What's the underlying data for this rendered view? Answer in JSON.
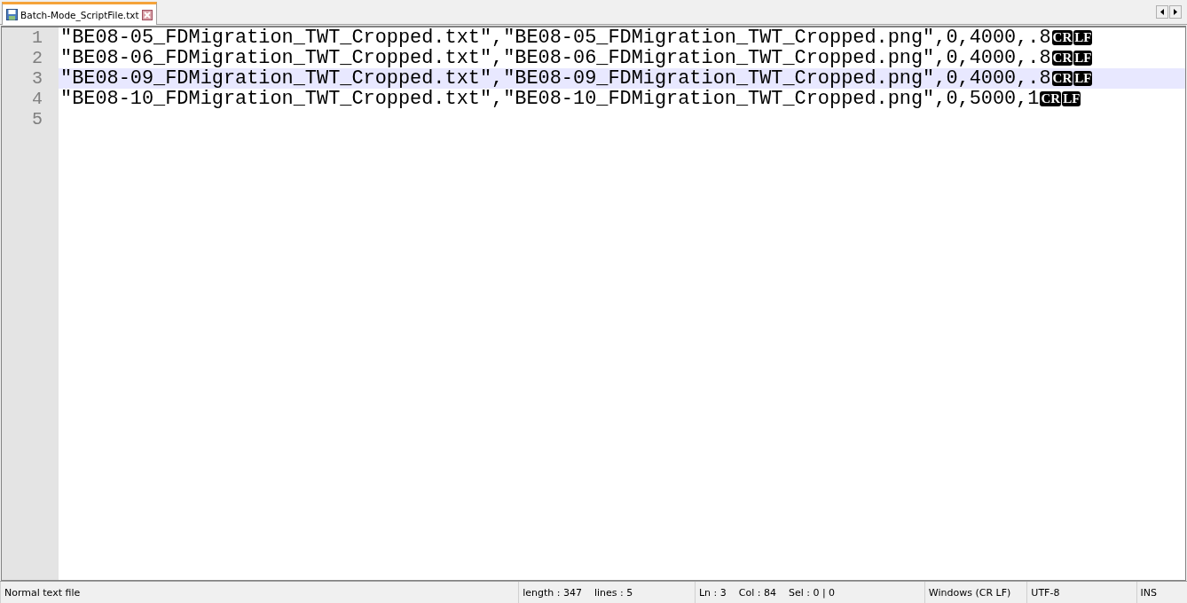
{
  "tabs": [
    {
      "label": "Batch-Mode_ScriptFile.txt",
      "selected": true
    }
  ],
  "editor": {
    "lines": [
      {
        "number": "1",
        "text": "\"BE08-05_FDMigration_TWT_Cropped.txt\",\"BE08-05_FDMigration_TWT_Cropped.png\",0,4000,.8",
        "eol": [
          "CR",
          "LF"
        ],
        "current": false
      },
      {
        "number": "2",
        "text": "\"BE08-06_FDMigration_TWT_Cropped.txt\",\"BE08-06_FDMigration_TWT_Cropped.png\",0,4000,.8",
        "eol": [
          "CR",
          "LF"
        ],
        "current": false
      },
      {
        "number": "3",
        "text": "\"BE08-09_FDMigration_TWT_Cropped.txt\",\"BE08-09_FDMigration_TWT_Cropped.png\",0,4000,.8",
        "eol": [
          "CR",
          "LF"
        ],
        "current": true
      },
      {
        "number": "4",
        "text": "\"BE08-10_FDMigration_TWT_Cropped.txt\",\"BE08-10_FDMigration_TWT_Cropped.png\",0,5000,1",
        "eol": [
          "CR",
          "LF"
        ],
        "current": false
      },
      {
        "number": "5",
        "current": false
      }
    ]
  },
  "status_bar": [
    "Normal text file",
    "length : 347    lines : 5",
    "Ln : 3    Col : 84    Sel : 0 | 0",
    "Windows (CR LF)",
    "UTF-8",
    "INS"
  ]
}
